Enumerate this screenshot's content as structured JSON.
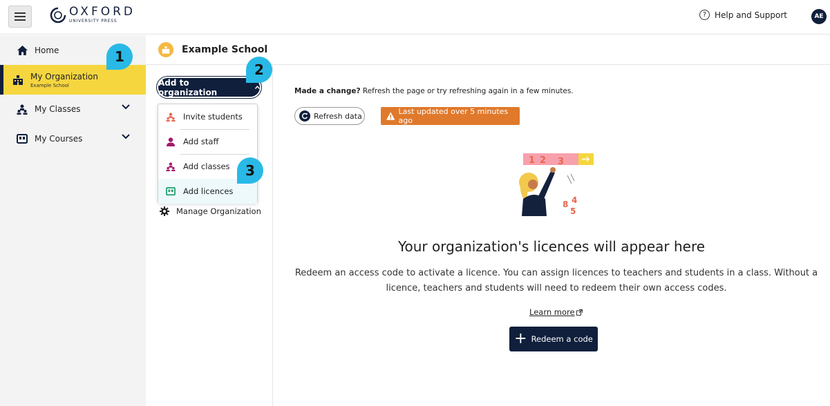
{
  "header": {
    "logo_main": "OXFORD",
    "logo_sub": "UNIVERSITY PRESS",
    "help_label": "Help and Support",
    "help_icon": "?",
    "avatar_initials": "AE"
  },
  "sidebar": {
    "items": [
      {
        "label": "Home",
        "icon": "home-icon"
      },
      {
        "label": "My Organization",
        "sublabel": "Example School",
        "icon": "organization-icon"
      },
      {
        "label": "My Classes",
        "icon": "classes-icon"
      },
      {
        "label": "My Courses",
        "icon": "courses-icon"
      }
    ]
  },
  "main": {
    "school_name": "Example School",
    "add_button_label": "Add to organization",
    "dropdown_items": [
      {
        "label": "Invite students",
        "icon": "students-icon"
      },
      {
        "label": "Add staff",
        "icon": "staff-icon"
      },
      {
        "label": "Add classes",
        "icon": "classes-icon"
      },
      {
        "label": "Add licences",
        "icon": "licences-icon"
      }
    ],
    "manage_label": "Manage Organization",
    "made_change_bold": "Made a change?",
    "made_change_text": " Refresh the page or try refreshing again in a few minutes.",
    "refresh_label": "Refresh data",
    "warning_label": "Last updated over 5 minutes ago",
    "empty_title": "Your organization's licences will appear here",
    "empty_desc": "Redeem an access code to activate a licence. You can assign licences to teachers and students in a class. Without a licence, teachers and students will need to redeem their own access codes.",
    "learn_more": "Learn more",
    "redeem_label": "Redeem a code"
  },
  "callouts": [
    "1",
    "2",
    "3"
  ],
  "colors": {
    "navy": "#0f1f3c",
    "highlight_yellow": "#f5d63f",
    "callout_blue": "#29b9e6",
    "warning_orange": "#e0792b"
  }
}
